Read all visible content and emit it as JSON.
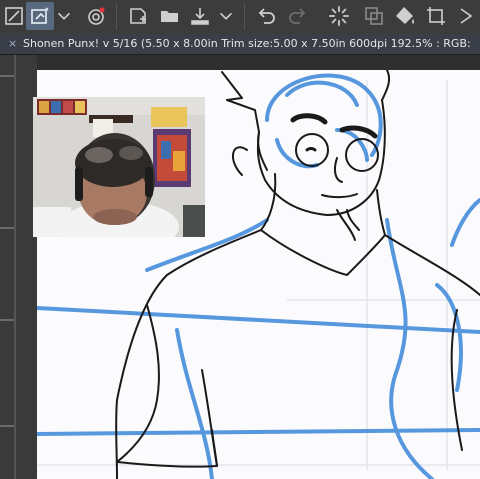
{
  "toolbar": {
    "buttons": [
      {
        "name": "transform-icon"
      },
      {
        "name": "subview-icon",
        "active": true
      },
      {
        "name": "chevron-down-icon"
      },
      {
        "name": "color-wheel-icon"
      },
      {
        "name": "new-layer-icon"
      },
      {
        "name": "open-folder-icon"
      },
      {
        "name": "export-icon"
      },
      {
        "name": "chevron-down-icon"
      },
      {
        "name": "undo-icon"
      },
      {
        "name": "redo-icon"
      },
      {
        "name": "loading-spinner-icon"
      },
      {
        "name": "copy-layer-icon"
      },
      {
        "name": "fill-bucket-icon"
      },
      {
        "name": "crop-icon"
      },
      {
        "name": "more-icon"
      }
    ]
  },
  "document": {
    "close_glyph": "×",
    "tab_title": "Shonen Punx! v 5/16 (5.50 x 8.00in Trim size:5.00 x 7.50in 600dpi 192.5% : RGB:"
  },
  "colors": {
    "accent": "#4a90e2",
    "blue_line": "#4a8fdc",
    "ink": "#1a1a1a",
    "canvas_bg": "#fbfbfd",
    "panel_bg": "#3c3c3c"
  }
}
